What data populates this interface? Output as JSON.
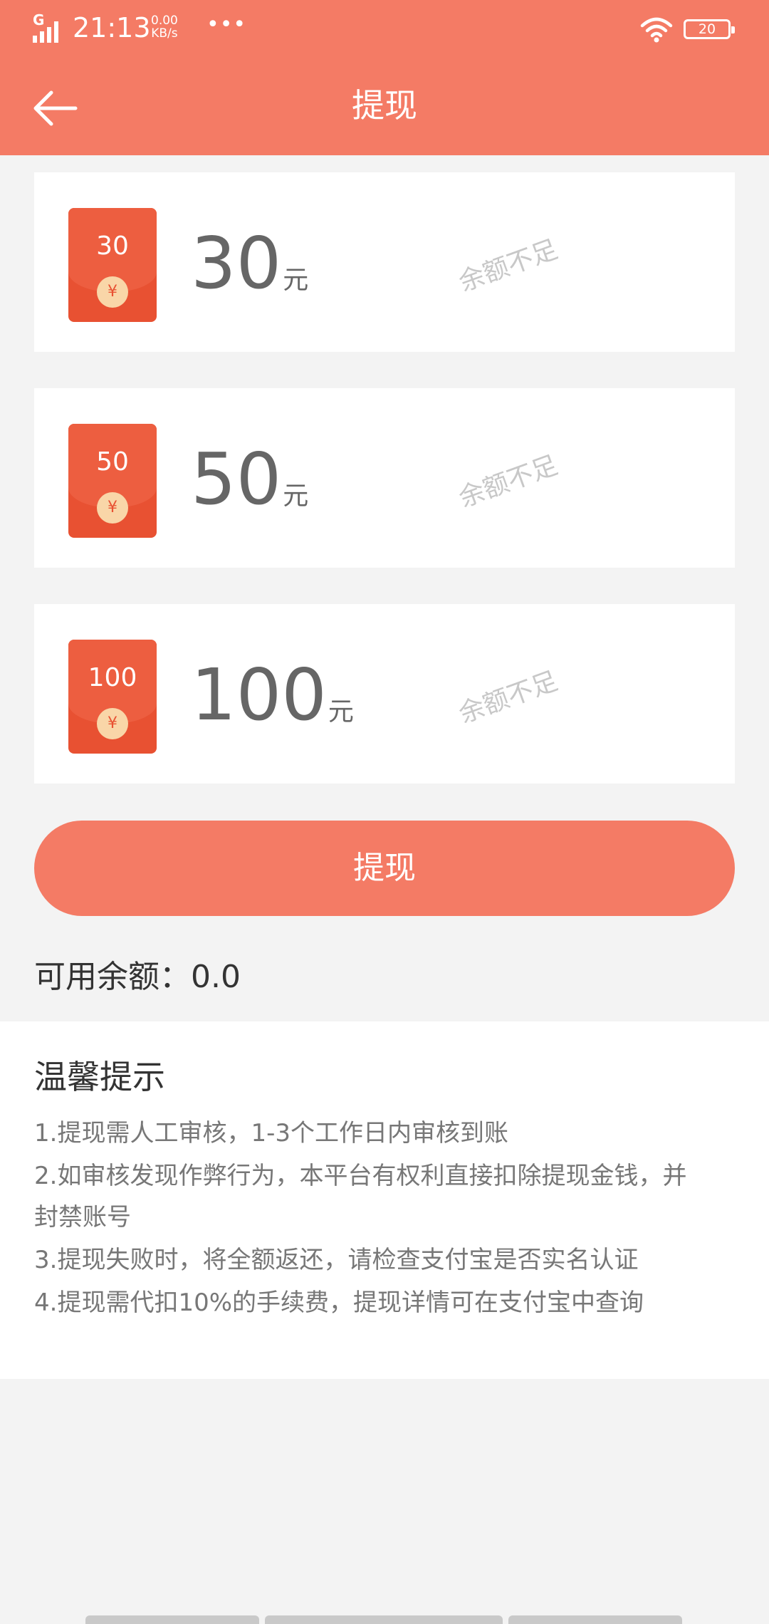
{
  "status_bar": {
    "network": "G",
    "time": "21:13",
    "speed_value": "0.00",
    "speed_unit": "KB/s",
    "more": "•••",
    "battery": "20"
  },
  "header": {
    "title": "提现",
    "back_icon": "arrow-left-icon"
  },
  "options": [
    {
      "badge": "30",
      "amount": "30",
      "unit": "元",
      "status": "余额不足"
    },
    {
      "badge": "50",
      "amount": "50",
      "unit": "元",
      "status": "余额不足"
    },
    {
      "badge": "100",
      "amount": "100",
      "unit": "元",
      "status": "余额不足"
    }
  ],
  "coin_symbol": "¥",
  "withdraw_button": "提现",
  "balance": "可用余额：0.0",
  "tips": {
    "heading": "温馨提示",
    "lines": [
      "1.提现需人工审核，1-3个工作日内审核到账",
      "2.如审核发现作弊行为，本平台有权利直接扣除提现金钱，并",
      "封禁账号",
      "3.提现失败时，将全额返还，请检查支付宝是否实名认证",
      "4.提现需代扣10%的手续费，提现详情可在支付宝中查询"
    ]
  },
  "colors": {
    "brand": "#f47b65",
    "red_packet": "#e85132",
    "coin": "#f9d6a8",
    "page_bg": "#f3f3f3"
  }
}
